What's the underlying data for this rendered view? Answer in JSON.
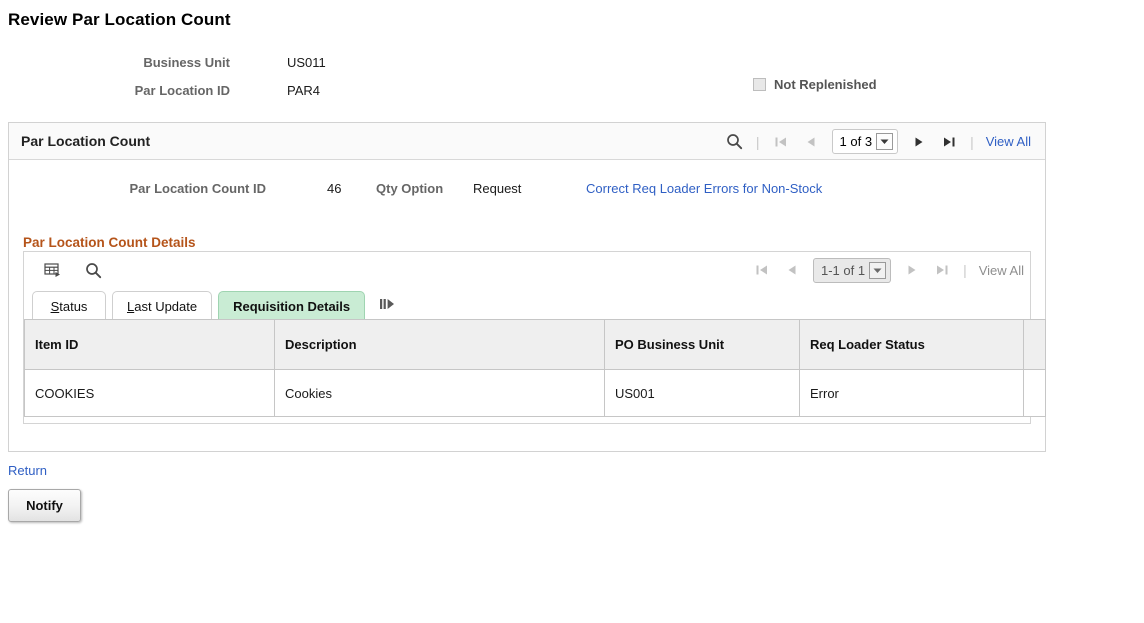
{
  "page": {
    "title": "Review Par Location Count"
  },
  "form": {
    "business_unit": {
      "label": "Business Unit",
      "value": "US011"
    },
    "par_location_id": {
      "label": "Par Location ID",
      "value": "PAR4"
    },
    "not_replenished": {
      "label": "Not Replenished",
      "checked": false,
      "disabled": true
    }
  },
  "panel": {
    "title": "Par Location Count",
    "nav": {
      "search_icon": "search-icon",
      "first_icon": "first-page-icon",
      "previous_icon": "previous-page-icon",
      "page_indicator": "1 of 3",
      "next_icon": "next-page-icon",
      "last_icon": "last-page-icon",
      "view_all": "View All",
      "separator": "|"
    },
    "detail": {
      "count_id_label": "Par Location Count ID",
      "count_id_value": "46",
      "qty_option_label": "Qty Option",
      "qty_option_value": "Request",
      "error_link": "Correct Req Loader Errors for Non-Stock"
    }
  },
  "details_section": {
    "caption": "Par Location Count Details",
    "toolbar": {
      "personalize_icon": "grid-personalize-icon",
      "find_icon": "search-icon"
    },
    "nav": {
      "first_icon": "first-page-icon",
      "previous_icon": "previous-page-icon",
      "page_indicator": "1-1 of 1",
      "next_icon": "next-page-icon",
      "last_icon": "last-page-icon",
      "view_all": "View All",
      "separator": "|"
    },
    "tabs": [
      {
        "label": "Status",
        "accel": "S",
        "rest": "tatus",
        "active": false
      },
      {
        "label": "Last Update",
        "accel": "L",
        "rest": "ast Update",
        "active": false
      },
      {
        "label": "Requisition Details",
        "accel": "",
        "rest": "Requisition Details",
        "active": true
      }
    ],
    "tab_more_icon": "show-next-tabs-icon",
    "grid": {
      "columns": [
        "Item ID",
        "Description",
        "PO Business Unit",
        "Req Loader Status",
        ""
      ],
      "rows": [
        [
          "COOKIES",
          "Cookies",
          "US001",
          "Error",
          ""
        ]
      ]
    }
  },
  "footer": {
    "return_link": "Return",
    "notify_button": "Notify"
  },
  "colors": {
    "link": "#2f5fc4",
    "caption": "#b5541a",
    "active_tab_bg": "#c9ecd4",
    "header_bg": "#fafafa",
    "grid_header_bg": "#efefef"
  }
}
